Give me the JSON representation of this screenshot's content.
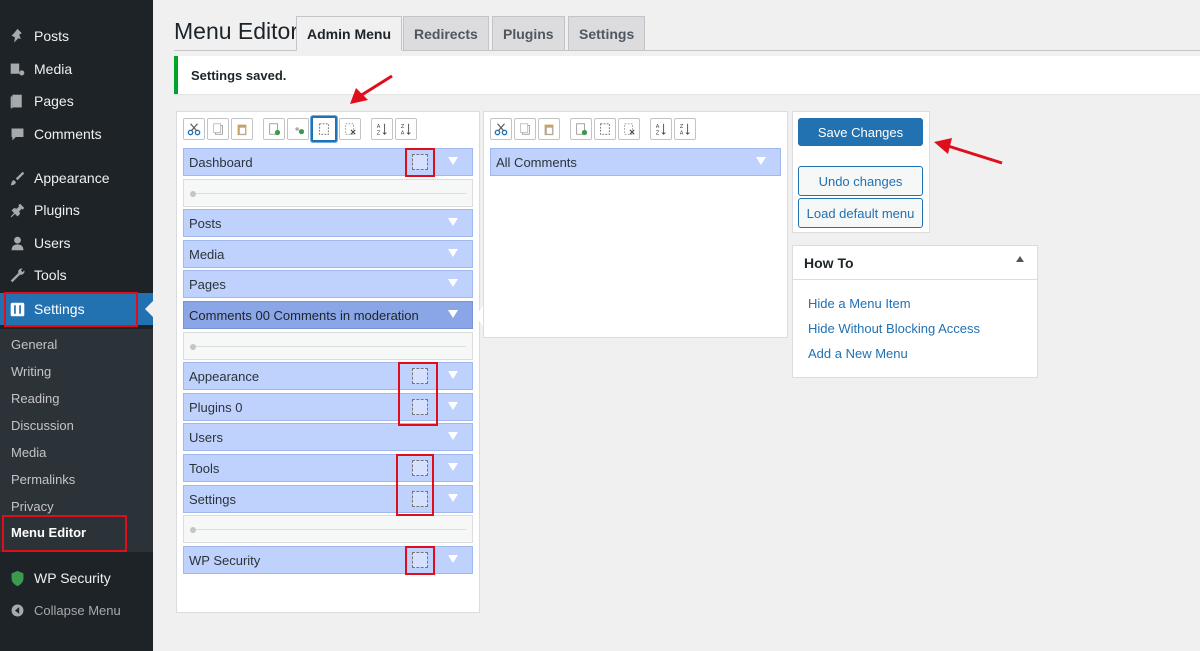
{
  "sidebar": {
    "items": [
      {
        "label": "Posts",
        "icon": "pushpin-icon"
      },
      {
        "label": "Media",
        "icon": "media-icon"
      },
      {
        "label": "Pages",
        "icon": "pages-icon"
      },
      {
        "label": "Comments",
        "icon": "comment-icon"
      },
      {
        "label": "Appearance",
        "icon": "brush-icon"
      },
      {
        "label": "Plugins",
        "icon": "plugin-icon"
      },
      {
        "label": "Users",
        "icon": "user-icon"
      },
      {
        "label": "Tools",
        "icon": "wrench-icon"
      },
      {
        "label": "Settings",
        "icon": "settings-icon"
      }
    ],
    "submenu": [
      "General",
      "Writing",
      "Reading",
      "Discussion",
      "Media",
      "Permalinks",
      "Privacy",
      "Menu Editor"
    ],
    "wp_security": "WP Security",
    "collapse": "Collapse Menu"
  },
  "header": {
    "title": "Menu Editor",
    "tabs": [
      "Admin Menu",
      "Redirects",
      "Plugins",
      "Settings"
    ]
  },
  "notice": "Settings saved.",
  "left_menu": [
    "Dashboard",
    "Posts",
    "Media",
    "Pages",
    "Comments 00 Comments in moderation",
    "Appearance",
    "Plugins 0",
    "Users",
    "Tools",
    "Settings",
    "WP Security"
  ],
  "right_menu": [
    "All Comments"
  ],
  "actions": {
    "save": "Save Changes",
    "undo": "Undo changes",
    "load_default": "Load default menu"
  },
  "howto": {
    "title": "How To",
    "links": [
      "Hide a Menu Item",
      "Hide Without Blocking Access",
      "Add a New Menu"
    ]
  },
  "colors": {
    "accent": "#2271b1",
    "highlight": "#e00d1b",
    "menu_item": "#bfd2fd"
  }
}
